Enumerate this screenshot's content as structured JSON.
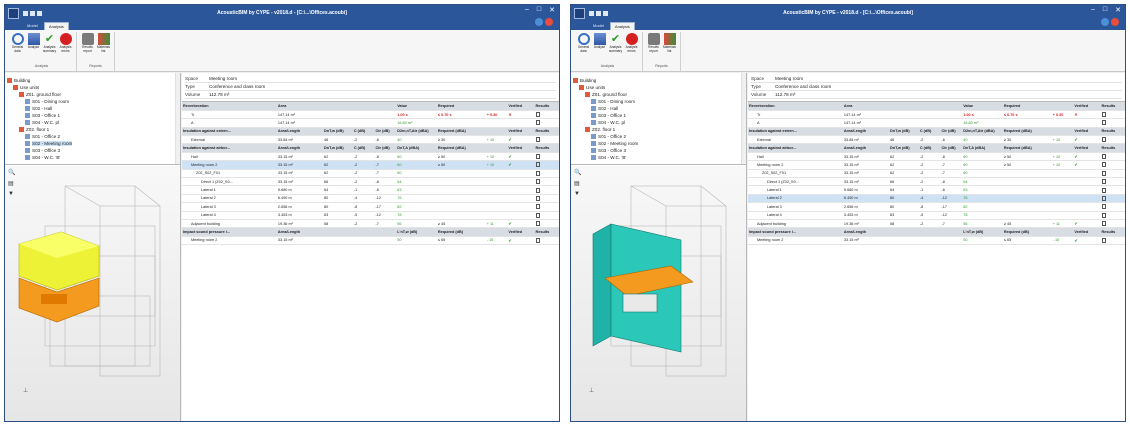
{
  "app_title": "AcousticBIM by CYPE - v2018.d - [C:\\...\\Offices.acoubi]",
  "window_controls": [
    "–",
    "□",
    "✕"
  ],
  "tabs": [
    "Model",
    "Analysis"
  ],
  "ribbon": {
    "groups": [
      {
        "label": "Analysis",
        "buttons": [
          "General data",
          "Analyse",
          "Analysis summary",
          "Analysis errors"
        ]
      },
      {
        "label": "Reports",
        "buttons": [
          "Results report",
          "Materials list"
        ]
      }
    ]
  },
  "tree": [
    {
      "label": "Building",
      "level": 0
    },
    {
      "label": "Use units",
      "level": 1
    },
    {
      "label": "Z01. ground floor",
      "level": 2
    },
    {
      "label": "S01 - Dining room",
      "level": 3
    },
    {
      "label": "S02 - Hall",
      "level": 3
    },
    {
      "label": "S03 - Office 1",
      "level": 3
    },
    {
      "label": "S04 - W.C. pl",
      "level": 3
    },
    {
      "label": "Z02. floor 1",
      "level": 2
    },
    {
      "label": "S01 - Office 2",
      "level": 3
    },
    {
      "label": "S02 - Meeting room",
      "level": 3
    },
    {
      "label": "S03 - Office 3",
      "level": 3
    },
    {
      "label": "S04 - W.C. 'B'",
      "level": 3
    }
  ],
  "space": {
    "space_label": "Space",
    "space": "Meeting room",
    "type_label": "Type",
    "type": "Conference and class room",
    "volume_label": "Volume",
    "volume": "112.78 m³"
  },
  "sections": {
    "reverb": {
      "title": "Reverberation",
      "cols": [
        "Area",
        "",
        "",
        "",
        "Value",
        "Required",
        "",
        "Verified",
        "Results"
      ]
    },
    "tr": {
      "name": "Tr",
      "area": "147.14 m²",
      "value": "1.00 s",
      "required": "≤ 0.70 s",
      "diff": "+ 0.30",
      "verified": "✕"
    },
    "a": {
      "name": "A",
      "area": "147.14 m²",
      "value": "16.80 m²"
    },
    "ins_ext": {
      "title": "Insulation against extern...",
      "cols": [
        "Area/Length",
        "DnT,w (dB)",
        "C (dB)",
        "Ctr (dB)",
        "D2m,nT,Atr (dBA)",
        "Required (dBA)",
        "",
        "Verified",
        "Results"
      ]
    },
    "external": {
      "name": "External",
      "area": "33.84 m²",
      "dntw": "46",
      "c": "-2",
      "ctr": "-6",
      "value": "40",
      "required": "≥ 30",
      "diff": "+ 10",
      "verified": "✔"
    },
    "ins_air": {
      "title": "Insulation against airbor...",
      "cols": [
        "Area/Length",
        "DnT,w (dB)",
        "C (dB)",
        "Ctr (dB)",
        "DnT,A (dBA)",
        "Required (dBA)",
        "",
        "Verified",
        "Results"
      ]
    },
    "impact": {
      "title": "Impact sound pressure l...",
      "cols": [
        "Area/Length",
        "",
        "",
        "",
        "L'nT,w (dB)",
        "Required (dB)",
        "",
        "Verified",
        "Results"
      ]
    },
    "meeting2_impact": {
      "name": "Meeting room 2",
      "area": "33.15 m²",
      "value": "50",
      "required": "≤ 65",
      "diff": "- 15",
      "verified": "✔"
    }
  },
  "airborne_rows": [
    {
      "name": "Hall",
      "area": "33.15 m²",
      "dntw": "62",
      "c": "-2",
      "ctr": "-8",
      "value": "60",
      "required": "≥ 50",
      "diff": "+ 10",
      "verified": "✔",
      "indent": 1
    },
    {
      "name": "Meeting room 2",
      "area": "33.15 m²",
      "dntw": "62",
      "c": "-2",
      "ctr": "-7",
      "value": "60",
      "required": "≥ 50",
      "diff": "+ 10",
      "verified": "✔",
      "indent": 1
    },
    {
      "name": "Z02_S02_F01",
      "area": "33.15 m²",
      "dntw": "62",
      "c": "-2",
      "ctr": "-7",
      "value": "60",
      "required": "",
      "diff": "",
      "verified": "",
      "indent": 2
    },
    {
      "name": "Direct 1 (Z02_S0...",
      "area": "33.15 m²",
      "dntw": "66",
      "c": "-2",
      "ctr": "-8",
      "value": "64",
      "required": "",
      "diff": "",
      "verified": "",
      "indent": 3
    },
    {
      "name": "Lateral 1",
      "area": "5.680 m",
      "dntw": "64",
      "c": "-1",
      "ctr": "-6",
      "value": "63",
      "required": "",
      "diff": "",
      "verified": "",
      "indent": 3
    },
    {
      "name": "Lateral 2",
      "area": "6.490 m",
      "dntw": "80",
      "c": "-4",
      "ctr": "-12",
      "value": "76",
      "required": "",
      "diff": "",
      "verified": "",
      "indent": 3
    },
    {
      "name": "Lateral 3",
      "area": "2.656 m",
      "dntw": "80",
      "c": "-8",
      "ctr": "-17",
      "value": "82",
      "required": "",
      "diff": "",
      "verified": "",
      "indent": 3
    },
    {
      "name": "Lateral 4",
      "area": "3.453 m",
      "dntw": "83",
      "c": "-5",
      "ctr": "-12",
      "value": "78",
      "required": "",
      "diff": "",
      "verified": "",
      "indent": 3
    },
    {
      "name": "Adjacent building",
      "area": "19.36 m²",
      "dntw": "58",
      "c": "-2",
      "ctr": "-7",
      "value": "56",
      "required": "≥ 45",
      "diff": "+ 11",
      "verified": "✔",
      "indent": 1
    }
  ]
}
